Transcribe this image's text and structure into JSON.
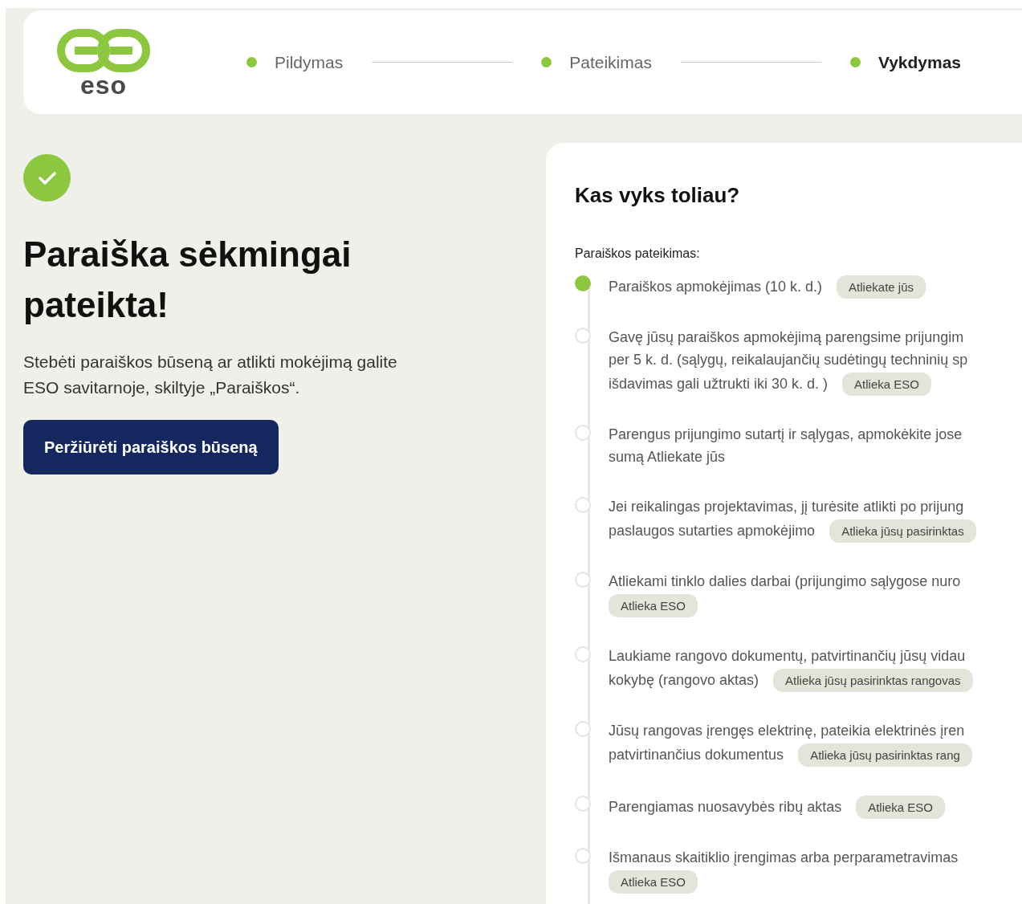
{
  "header": {
    "logo_text": "eso",
    "steps": [
      {
        "label": "Pildymas",
        "selected": false
      },
      {
        "label": "Pateikimas",
        "selected": false
      },
      {
        "label": "Vykdymas",
        "selected": true
      }
    ]
  },
  "success": {
    "title": "Paraiška sėkmingai pateikta!",
    "text": "Stebėti paraiškos būseną ar atlikti mokėjimą galite ESO savitarnoje, skiltyje „Paraiškos“.",
    "button": "Peržiūrėti paraiškos būseną"
  },
  "next": {
    "title": "Kas vyks toliau?",
    "section_label": "Paraiškos pateikimas:",
    "steps": [
      {
        "lines": [
          "Paraiškos apmokėjimas (10 k. d.)"
        ],
        "tag": "Atliekate jūs",
        "active": true
      },
      {
        "lines": [
          "Gavę jūsų paraiškos apmokėjimą parengsime prijungim",
          "per 5 k. d. (sąlygų, reikalaujančių sudėtingų techninių sp",
          "išdavimas gali užtrukti iki 30 k. d. )"
        ],
        "tag": "Atlieka ESO",
        "active": false
      },
      {
        "lines": [
          "Parengus prijungimo sutartį ir sąlygas, apmokėkite jose",
          "sumą Atliekate jūs"
        ],
        "active": false
      },
      {
        "lines": [
          "Jei reikalingas projektavimas, jį turėsite atlikti po prijung",
          "paslaugos sutarties apmokėjimo"
        ],
        "tag": "Atlieka jūsų pasirinktas",
        "active": false
      },
      {
        "lines": [
          "Atliekami tinklo dalies darbai (prijungimo sąlygose nuro"
        ],
        "tag": "Atlieka ESO",
        "active": false
      },
      {
        "lines": [
          "Laukiame rangovo dokumentų, patvirtinančių jūsų vidau",
          "kokybę (rangovo aktas)"
        ],
        "tag": "Atlieka jūsų pasirinktas rangovas",
        "active": false
      },
      {
        "lines": [
          "Jūsų rangovas įrengęs elektrinę, pateikia elektrinės įren",
          "patvirtinančius dokumentus"
        ],
        "tag": "Atlieka jūsų pasirinktas rang",
        "active": false
      },
      {
        "lines": [
          "Parengiamas nuosavybės ribų aktas"
        ],
        "tag": "Atlieka ESO",
        "active": false
      },
      {
        "lines": [
          "Išmanaus skaitiklio įrengimas arba perparametravimas"
        ],
        "tag": "Atlieka ESO",
        "active": false
      }
    ]
  }
}
